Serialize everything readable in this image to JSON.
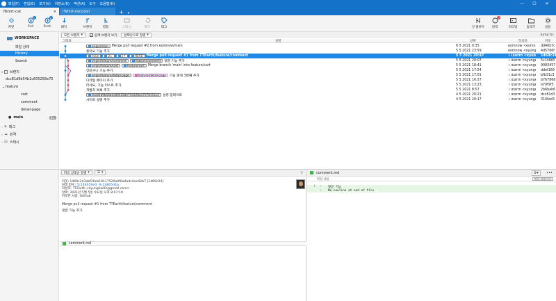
{
  "menu": {
    "items": [
      "파일(F)",
      "편집(E)",
      "보기(V)",
      "저장소(R)",
      "액션(A)",
      "도구",
      "도움말(H)"
    ]
  },
  "window_controls": [
    "—",
    "☐",
    "✕"
  ],
  "tabs": [
    {
      "label": "iTshirt-cat",
      "active": true
    },
    {
      "label": "iTshirt-raccoon",
      "active": false
    }
  ],
  "toolbar": {
    "left": [
      {
        "label": "커밋",
        "icon": "commit-icon"
      },
      {
        "label": "Pull",
        "icon": "pull-icon",
        "badge": "1"
      },
      {
        "label": "Push",
        "icon": "push-icon",
        "badge": "2"
      },
      {
        "label": "패치",
        "icon": "fetch-icon"
      },
      {
        "label": "브랜치",
        "icon": "branch-icon"
      },
      {
        "label": "병합",
        "icon": "merge-icon"
      },
      {
        "label": "스태시",
        "icon": "stash-icon",
        "disabled": true
      },
      {
        "label": "폐기",
        "icon": "discard-icon",
        "disabled": true
      },
      {
        "label": "태그",
        "icon": "tag-icon"
      }
    ],
    "right": [
      {
        "label": "깃 플로우",
        "icon": "git-flow-icon"
      },
      {
        "label": "원격",
        "icon": "remote-icon",
        "badge": "!"
      },
      {
        "label": "터미널",
        "icon": "terminal-icon"
      },
      {
        "label": "탐색기",
        "icon": "explorer-icon"
      },
      {
        "label": "설정",
        "icon": "settings-icon"
      }
    ]
  },
  "sidebar": {
    "workspace": "WORKSPACE",
    "workspace_items": [
      "파일 상태",
      "History",
      "Search"
    ],
    "branches_header": "브랜치",
    "branches": [
      {
        "label": "dcc81d9b54b1c805258e75",
        "indent": 1
      },
      {
        "label": "feature",
        "indent": 1,
        "folder": true
      },
      {
        "label": "cart",
        "indent": 2
      },
      {
        "label": "comment",
        "indent": 2
      },
      {
        "label": "detail-page",
        "indent": 2
      },
      {
        "label": "main",
        "indent": 0,
        "current": true,
        "count": "2↓"
      }
    ],
    "sections": [
      "태그",
      "원격",
      "스태시"
    ]
  },
  "filters": {
    "all_branches": "모든 브랜치",
    "show_remote": "원격 브랜치 보기",
    "date_order": "날짜순으로 정렬",
    "jump": "Jump to:"
  },
  "columns": {
    "graph": "그래프",
    "desc": "설명",
    "date": "날짜",
    "author": "작성자",
    "commit": "커밋"
  },
  "commits": [
    {
      "refs": [
        {
          "t": "origin/main",
          "k": "remote"
        }
      ],
      "msg": "Merge pull request #2 from eomnow/main",
      "date": "6 5 2021 0:35",
      "author": "eomnow <eomn",
      "hash": "dd40b7c"
    },
    {
      "refs": [],
      "msg": "좋아요 기능 추가",
      "date": "5 5 2021 23:59",
      "author": "eomnow <kyungkw",
      "hash": "4d5766f"
    },
    {
      "refs": [
        {
          "t": "main",
          "k": "head"
        },
        {
          "t": "2↓",
          "k": "head"
        },
        {
          "t": "1↑",
          "k": "head"
        },
        {
          "t": "HEAD",
          "k": "head"
        }
      ],
      "msg": "Merge pull request #1 from TTEarth/feature/comment",
      "date": "5 5 2021 20:47",
      "author": "TTEarth <kyungk",
      "hash": "1469c24",
      "selected": true
    },
    {
      "refs": [
        {
          "t": "origin/feature/comment",
          "k": "remote"
        },
        {
          "t": "feature/comment",
          "k": "local"
        }
      ],
      "msg": "댓글 기능 추가",
      "date": "5 5 2021 20:07",
      "author": "TTEarth <kyungkw",
      "hash": "5c14865"
    },
    {
      "refs": [
        {
          "t": "origin/feature/cart",
          "k": "remote"
        },
        {
          "t": "feature/cart",
          "k": "local"
        }
      ],
      "msg": "Merge branch 'main' into feature/cart",
      "date": "5 5 2021 18:41",
      "author": "TTEarth <kyungkw",
      "hash": "9083457"
    },
    {
      "refs": [],
      "msg": "장바구니 기능 추가",
      "date": "5 5 2021 17:54",
      "author": "TTEarth <kyungkw",
      "hash": "ddef169"
    },
    {
      "refs": [
        {
          "t": "origin/feature/detail-page",
          "k": "remote"
        },
        {
          "t": "feature/detail-page",
          "k": "tag"
        }
      ],
      "msg": "기능 명세 3번째 추가",
      "date": "5 5 2021 17:01",
      "author": "TTEarth <kyungkw",
      "hash": "bfb31c3"
    },
    {
      "refs": [],
      "msg": "디테일 페이지 추가",
      "date": "5 5 2021 16:57",
      "author": "TTEarth <kyungkw",
      "hash": "b767868"
    },
    {
      "refs": [],
      "msg": "미세요, 기능 리스트 추가",
      "date": "5 5 2021 13:23",
      "author": "TTEarth <kyungkw",
      "hash": "b70f9f5"
    },
    {
      "refs": [],
      "msg": "개발자 목록 추가",
      "date": "5 5 2021 8:57",
      "author": "TTEarth <kyungkw",
      "hash": "2b6bab6"
    },
    {
      "refs": [
        {
          "t": "dcc81d9b54b1c805258e754528a17578112c2",
          "k": "remote"
        }
      ],
      "msg": "설명 업데이트",
      "date": "4 5 2021 20:21",
      "author": "TTEarth <kyungkw",
      "hash": "dcc81d3"
    },
    {
      "refs": [],
      "msg": "사이트 설명 추가",
      "date": "4 5 2021 20:17",
      "author": "TTEarth <kyungkw",
      "hash": "316fed3"
    }
  ],
  "detail": {
    "filter_label": "파일 상태순 정렬",
    "lines": [
      {
        "k": "커밋:",
        "v": "1469c243ebf20cb19117520a0f0a4adc4ae42b7 [1469c24]"
      },
      {
        "k": "원래 향수:",
        "v": "5c148659e0, 9c14865d4a",
        "link": true
      },
      {
        "k": "작성자:",
        "v": "TTEarth <kyungkw92@gmail.com>"
      },
      {
        "k": "날짜:",
        "v": "2021년 5월 5일 수요일 오후 8:47:19"
      },
      {
        "k": "커밋한 사람:",
        "v": "GitHub"
      }
    ],
    "message": "Merge pull request #1 from TTEarth/feature/comment",
    "message2": "댓글 기능 추가",
    "file": "comment.md"
  },
  "diff": {
    "file": "comment.md",
    "hunk": "파일 내용",
    "revert": "파일 되돌리기",
    "lines": [
      {
        "n": "1",
        "sign": "+",
        "text": "댓글 기능",
        "add": true
      },
      {
        "n": "",
        "sign": "\\",
        "text": "No newline at end of file",
        "add": true
      }
    ]
  },
  "colors": {
    "accent": "#1473c8",
    "selection": "#1e8ae6",
    "graph1": "#1e7ad8",
    "graph2": "#c8506e",
    "graph3": "#8a4fb8"
  }
}
